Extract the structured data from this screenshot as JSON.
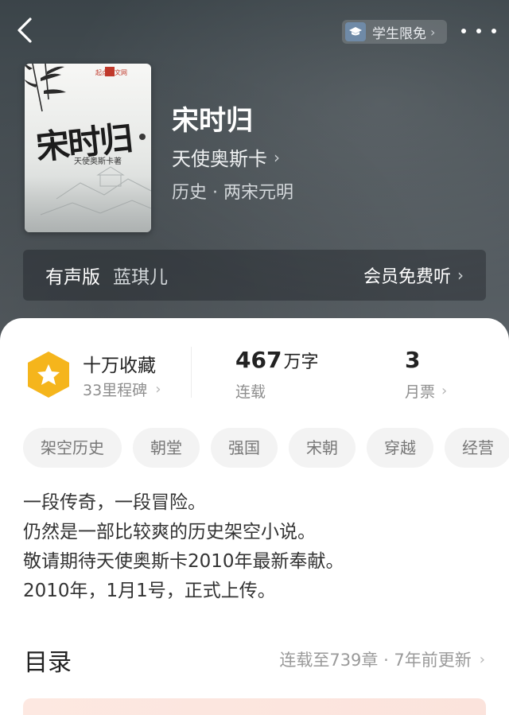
{
  "header": {
    "student_badge": "学生限免",
    "icons": {
      "back": "back-arrow-icon",
      "more": "more-dots-icon",
      "student": "graduation-cap-icon"
    }
  },
  "book": {
    "title": "宋时归",
    "author": "天使奥斯卡",
    "genre": "历史 · 两宋元明",
    "cover": {
      "title": "宋时归",
      "author": "天使奥斯卡著",
      "publisher": "起点中文网"
    }
  },
  "audio": {
    "label": "有声版",
    "narrator": "蓝琪儿",
    "action": "会员免费听"
  },
  "stats": {
    "collect_main": "十万收藏",
    "collect_sub": "33里程碑",
    "words_num": "467",
    "words_unit": "万字",
    "words_sub": "连载",
    "tickets_num": "3",
    "tickets_sub": "月票"
  },
  "tags": [
    "架空历史",
    "朝堂",
    "强国",
    "宋朝",
    "穿越",
    "经营"
  ],
  "description": [
    "一段传奇，一段冒险。",
    "仍然是一部比较爽的历史架空小说。",
    "敬请期待天使奥斯卡2010年最新奉献。",
    "2010年，1月1号，正式上传。"
  ],
  "toc": {
    "title": "目录",
    "status": "连载至739章 · 7年前更新"
  },
  "colors": {
    "hero_bg": "#4a5257",
    "badge_gold": "#f5b51c",
    "text_main": "#222222",
    "text_muted": "#8e8e8e",
    "promo_bg": "#fde8e1"
  }
}
